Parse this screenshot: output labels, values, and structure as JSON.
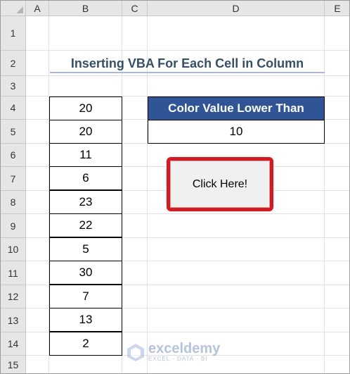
{
  "columns": [
    "A",
    "B",
    "C",
    "D",
    "E"
  ],
  "rows": [
    "1",
    "2",
    "3",
    "4",
    "5",
    "6",
    "7",
    "8",
    "9",
    "10",
    "11",
    "12",
    "13",
    "14",
    "15"
  ],
  "title": "Inserting VBA For Each Cell in Column",
  "values_b": [
    "20",
    "20",
    "11",
    "6",
    "23",
    "22",
    "5",
    "30",
    "7",
    "13",
    "2"
  ],
  "criteria": {
    "header": "Color Value Lower Than",
    "value": "10"
  },
  "button": {
    "label": "Click Here!"
  },
  "watermark": {
    "name": "exceldemy",
    "tagline": "EXCEL · DATA · BI"
  },
  "colors": {
    "header_fill": "#2f5597",
    "title_text": "#34506b",
    "button_border": "#e0141b"
  }
}
